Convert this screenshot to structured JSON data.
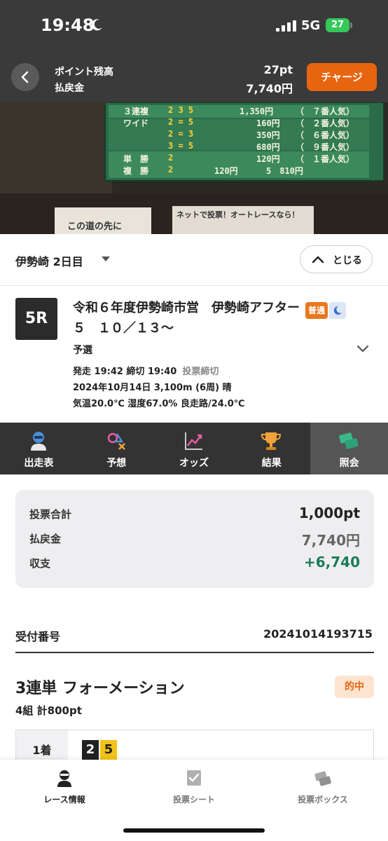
{
  "status_bar": {
    "time": "19:48",
    "network": "5G",
    "battery": "27"
  },
  "points": {
    "balance_label": "ポイント残高",
    "payout_label": "払戻金",
    "balance_value": "27pt",
    "payout_value": "7,740円",
    "charge_label": "チャージ"
  },
  "video": {
    "rows": [
      {
        "bet": "３連複",
        "combo": "2 3 5",
        "odds": "1,350円",
        "pop": "（　７番人気）"
      },
      {
        "bet": "ワイド",
        "combo": "2 = 5",
        "odds": "160円",
        "pop": "（　２番人気）"
      },
      {
        "bet": "",
        "combo": "2 = 3",
        "odds": "350円",
        "pop": "（　６番人気）"
      },
      {
        "bet": "",
        "combo": "3 = 5",
        "odds": "680円",
        "pop": "（　９番人気）"
      },
      {
        "bet": "単　勝",
        "combo": "2",
        "odds": "120円",
        "pop": "（　１番人気）"
      },
      {
        "bet": "複　勝",
        "combo": "2",
        "odds": "120円",
        "pop": "5　810円"
      }
    ],
    "banner_left": "この道の先に",
    "banner_right": "ネットで投票！オートレースなら！"
  },
  "selector": {
    "venue": "伊勢崎 2日目",
    "close_label": "とじる"
  },
  "race": {
    "number": "5R",
    "title": "令和６年度伊勢崎市営　伊勢崎アフター５　１０／１３〜",
    "badge_type": "普通",
    "class": "予選",
    "line1": "発走 19:42 締切 19:40",
    "line1_status": "投票締切",
    "line2": "2024年10月14日 3,100m (6周) 晴",
    "line3": "気温20.0℃ 湿度67.0% 良走路/24.0℃"
  },
  "tabs": [
    {
      "label": "出走表",
      "icon": "racer-icon"
    },
    {
      "label": "予想",
      "icon": "prediction-icon"
    },
    {
      "label": "オッズ",
      "icon": "odds-chart-icon"
    },
    {
      "label": "結果",
      "icon": "trophy-icon"
    },
    {
      "label": "照会",
      "icon": "ticket-icon"
    }
  ],
  "summary": {
    "total_label": "投票合計",
    "total_value": "1,000pt",
    "payout_label": "払戻金",
    "payout_value": "7,740円",
    "balance_label": "収支",
    "balance_value": "+6,740"
  },
  "receipt": {
    "label": "受付番号",
    "value": "20241014193715"
  },
  "bet": {
    "type": "3連単 フォーメーション",
    "result": "的中",
    "count": "4組 計800pt",
    "first_label": "1着",
    "first_numbers": [
      "2",
      "5"
    ]
  },
  "bottom_nav": [
    {
      "label": "レース情報",
      "icon": "race-info-icon"
    },
    {
      "label": "投票シート",
      "icon": "ballot-sheet-icon"
    },
    {
      "label": "投票ボックス",
      "icon": "ballot-box-icon"
    }
  ],
  "colors": {
    "accent": "#e8650f",
    "header_bg": "#3a3a3a",
    "tab_bg": "#333333",
    "positive": "#1c7a5a"
  }
}
